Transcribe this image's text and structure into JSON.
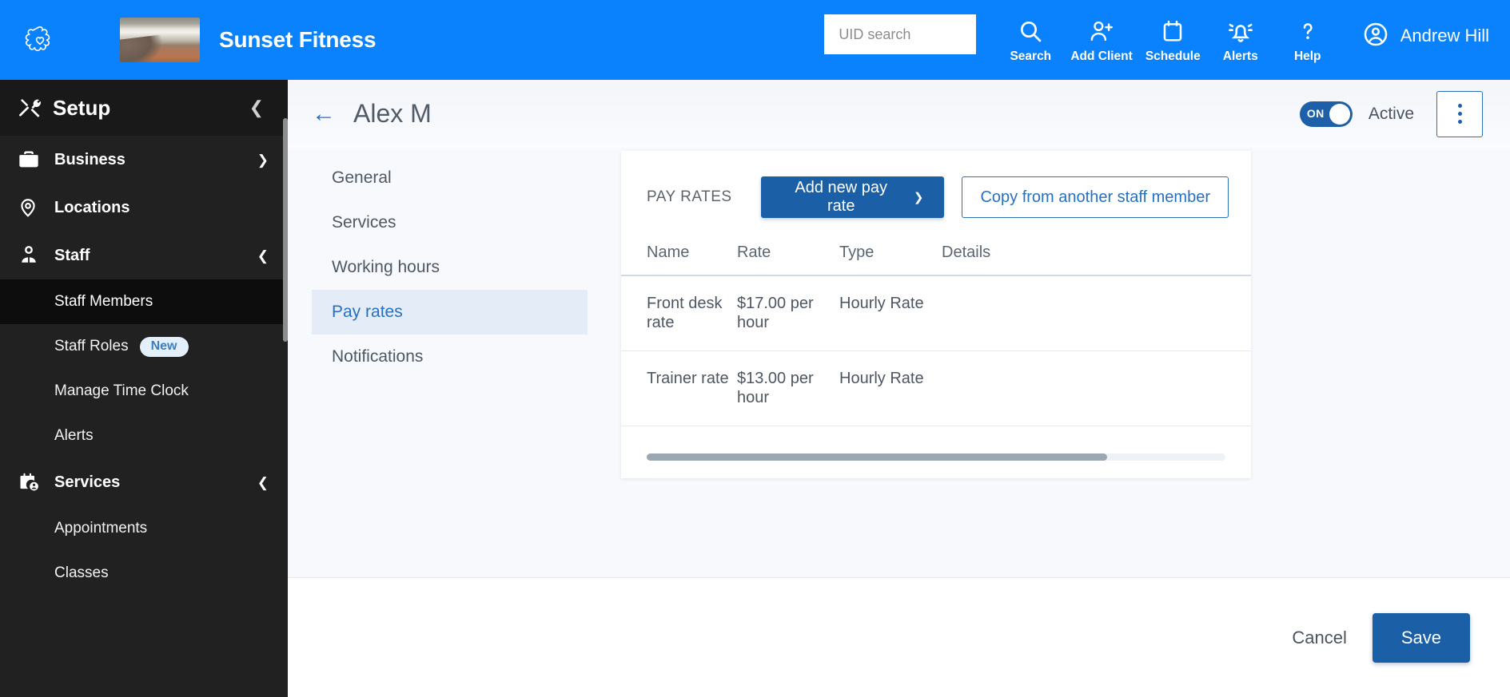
{
  "topbar": {
    "logo_icon": "flower-logo-icon",
    "brand_thumb_name": "sunset-landscape-thumbnail",
    "brand_title": "Sunset Fitness",
    "search": {
      "placeholder": "UID search",
      "value": ""
    },
    "nav": [
      {
        "icon": "search-icon",
        "label": "Search"
      },
      {
        "icon": "add-user-icon",
        "label": "Add Client"
      },
      {
        "icon": "calendar-icon",
        "label": "Schedule"
      },
      {
        "icon": "bell-icon",
        "label": "Alerts"
      },
      {
        "icon": "question-icon",
        "label": "Help"
      }
    ],
    "user": {
      "icon": "account-circle-icon",
      "name": "Andrew Hill"
    },
    "accent_color": "#0b82fd"
  },
  "sidebar": {
    "header": {
      "icon": "tools-icon",
      "title": "Setup",
      "collapse_icon": "chevron-left-icon"
    },
    "items": [
      {
        "type": "group",
        "icon": "briefcase-icon",
        "label": "Business",
        "chevron": "chevron-down-icon"
      },
      {
        "type": "group",
        "icon": "map-pin-icon",
        "label": "Locations",
        "chevron": ""
      },
      {
        "type": "group",
        "icon": "staff-icon",
        "label": "Staff",
        "chevron": "chevron-up-icon"
      },
      {
        "type": "sub",
        "label": "Staff Members",
        "active": true,
        "badge": ""
      },
      {
        "type": "sub",
        "label": "Staff Roles",
        "active": false,
        "badge": "New"
      },
      {
        "type": "sub",
        "label": "Manage Time Clock",
        "active": false,
        "badge": ""
      },
      {
        "type": "sub",
        "label": "Alerts",
        "active": false,
        "badge": ""
      },
      {
        "type": "group",
        "icon": "calendar-person-icon",
        "label": "Services",
        "chevron": "chevron-up-icon"
      },
      {
        "type": "sub",
        "label": "Appointments",
        "active": false,
        "badge": ""
      },
      {
        "type": "sub",
        "label": "Classes",
        "active": false,
        "badge": ""
      }
    ],
    "bg_color": "#212121"
  },
  "main": {
    "header": {
      "back_icon": "arrow-left-icon",
      "title": "Alex M",
      "toggle": {
        "state_label": "ON",
        "on": true
      },
      "status_label": "Active",
      "kebab_icon": "more-vertical-icon"
    },
    "tabs": [
      {
        "label": "General",
        "active": false
      },
      {
        "label": "Services",
        "active": false
      },
      {
        "label": "Working hours",
        "active": false
      },
      {
        "label": "Pay rates",
        "active": true
      },
      {
        "label": "Notifications",
        "active": false
      }
    ],
    "card": {
      "title": "PAY RATES",
      "add_button": {
        "label": "Add new pay rate",
        "chevron": "chevron-down-icon"
      },
      "copy_button": {
        "label": "Copy from another staff member"
      },
      "table": {
        "columns": [
          "Name",
          "Rate",
          "Type",
          "Details"
        ],
        "rows": [
          {
            "name": "Front desk rate",
            "rate": "$17.00 per hour",
            "type": "Hourly Rate",
            "details": ""
          },
          {
            "name": "Trainer rate",
            "rate": "$13.00 per hour",
            "type": "Hourly Rate",
            "details": ""
          }
        ]
      },
      "scrollbar": {
        "name": "horizontal-scrollbar"
      }
    }
  },
  "footer": {
    "cancel_label": "Cancel",
    "save_label": "Save"
  },
  "colors": {
    "brand_blue": "#0b82fd",
    "button_blue": "#1b5fa7",
    "link_blue": "#2870bf",
    "sidebar_dark": "#212121",
    "tab_active_bg": "#e4ecf7",
    "badge_bg": "#e3f0fb"
  }
}
